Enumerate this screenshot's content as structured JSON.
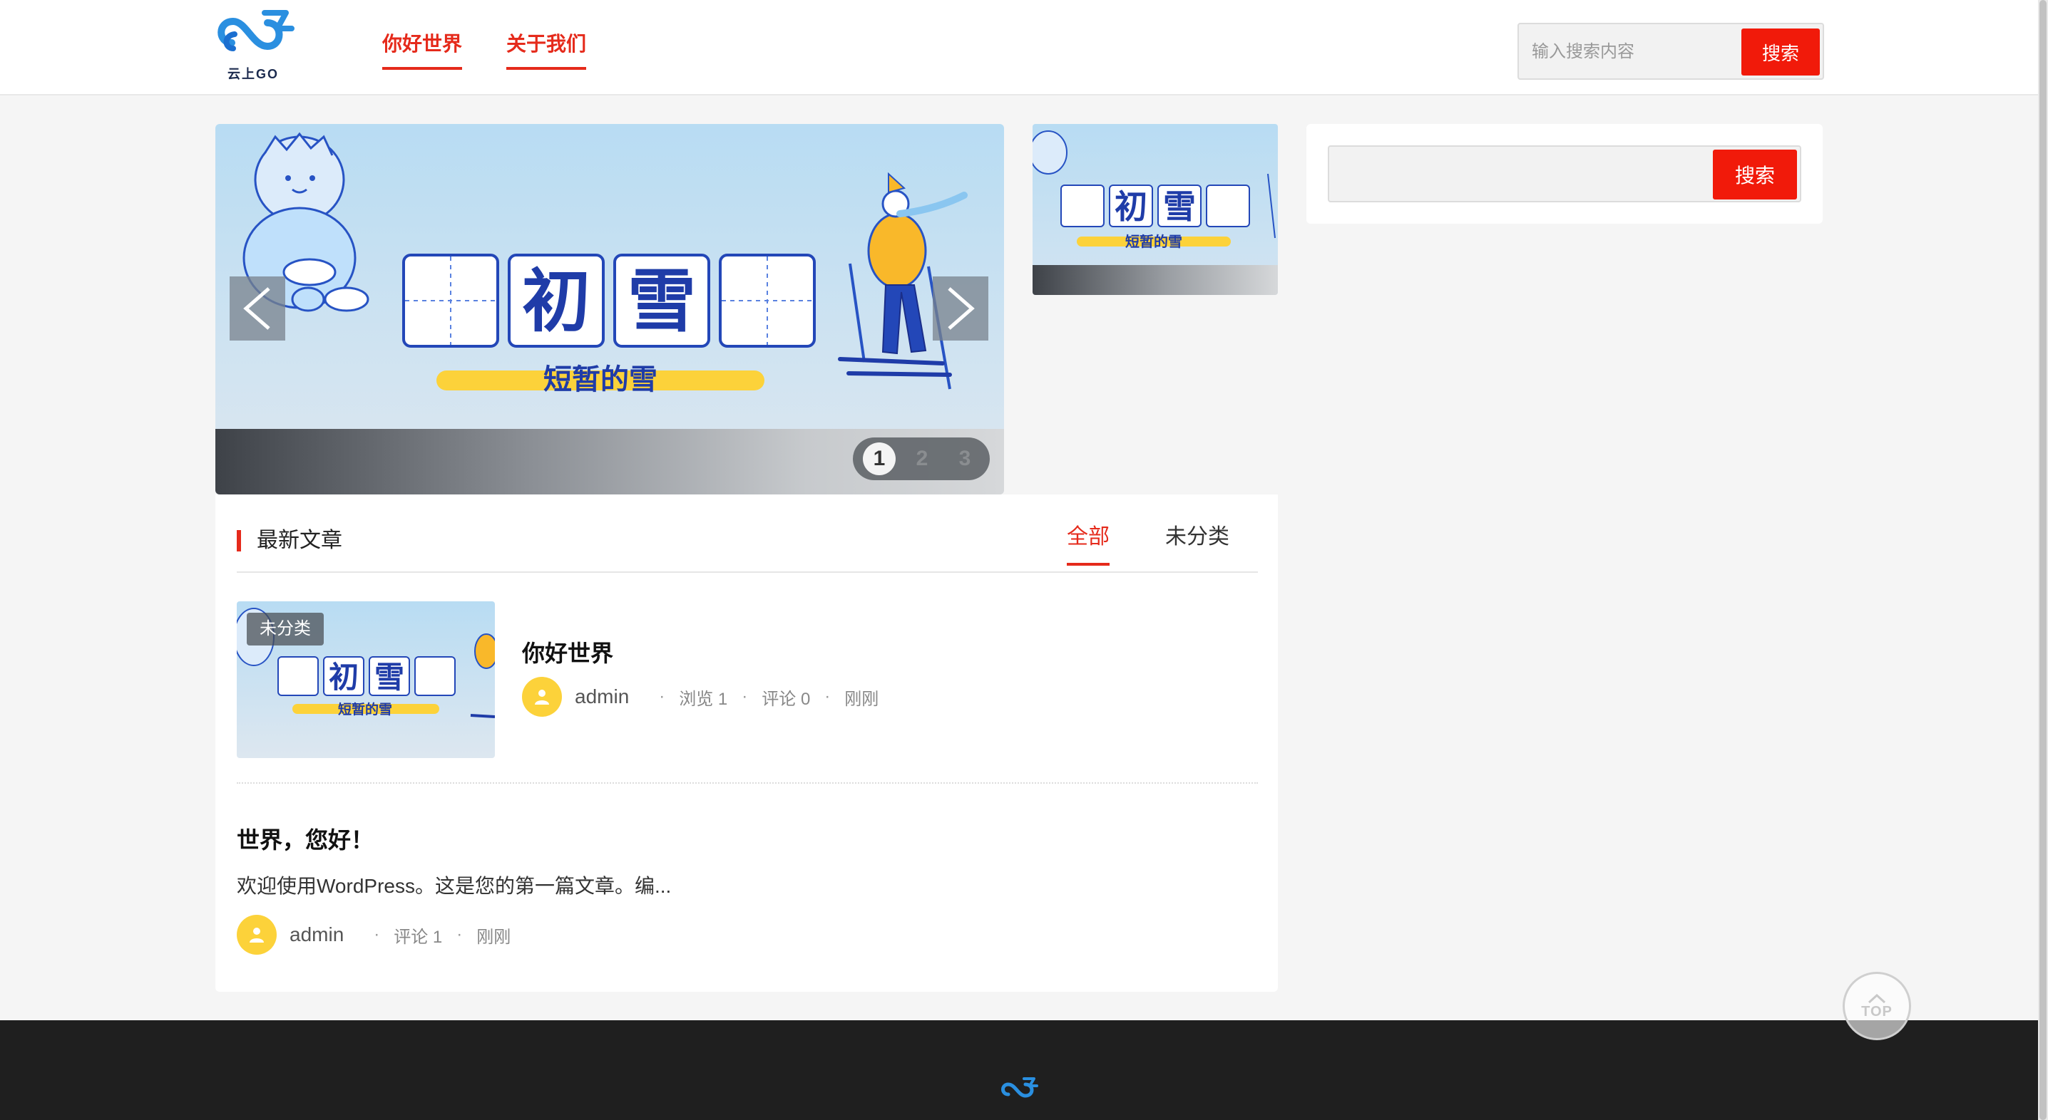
{
  "brand": {
    "logo_text": "云上GO"
  },
  "nav": {
    "items": [
      {
        "label": "你好世界"
      },
      {
        "label": "关于我们"
      }
    ]
  },
  "header_search": {
    "placeholder": "输入搜索内容",
    "button": "搜索"
  },
  "slider": {
    "banner": {
      "title_chars": [
        "初",
        "雪"
      ],
      "subtitle": "短暂的雪"
    },
    "pagination": [
      "1",
      "2",
      "3"
    ],
    "active_page": 1
  },
  "sidebar_search": {
    "button": "搜索"
  },
  "latest": {
    "title": "最新文章",
    "tabs": [
      {
        "label": "全部"
      },
      {
        "label": "未分类"
      }
    ],
    "posts": [
      {
        "badge": "未分类",
        "title": "你好世界",
        "author": "admin",
        "views": "浏览 1",
        "comments": "评论 0",
        "time": "刚刚"
      },
      {
        "title": "世界，您好！",
        "excerpt": "欢迎使用WordPress。这是您的第一篇文章。编...",
        "author": "admin",
        "comments": "评论 1",
        "time": "刚刚"
      }
    ]
  },
  "top_button": {
    "label": "TOP"
  },
  "colors": {
    "accent": "#e52a1b",
    "button": "#f11a0a",
    "footer": "#1f1f1f",
    "avatar": "#fcd23a"
  }
}
